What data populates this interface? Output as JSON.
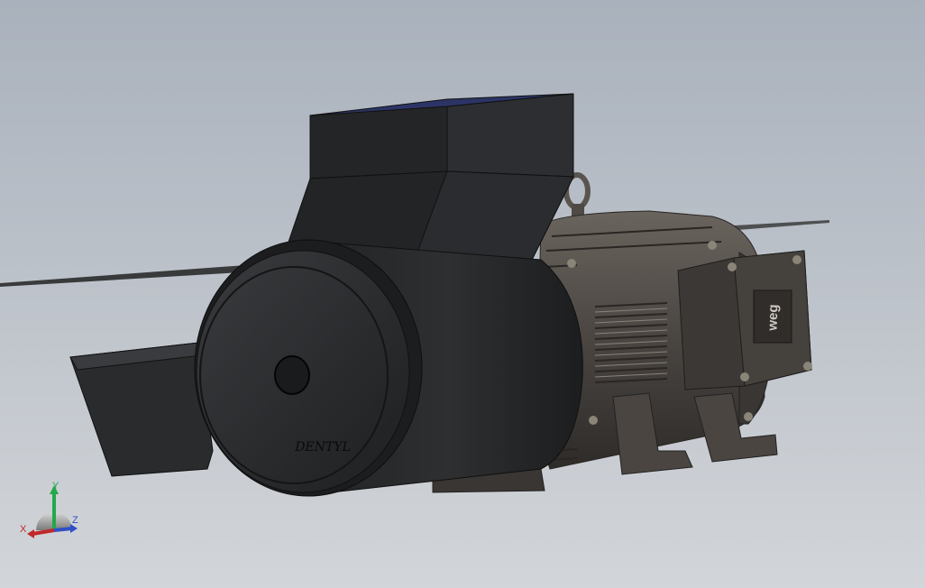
{
  "viewport": {
    "background_top": "#a9b1bc",
    "background_bottom": "#d2d5d9"
  },
  "model": {
    "hopper_color": "#2b2c2e",
    "motor_color": "#4a4541",
    "hopper_top_face_color": "#2c3466",
    "handwritten_marking": "DENTYL",
    "nameplate_logo": "weg"
  },
  "triad": {
    "x_label": "X",
    "y_label": "Y",
    "z_label": "Z",
    "x_color": "#c0282a",
    "y_color": "#23a84a",
    "z_color": "#2f4fc4"
  }
}
